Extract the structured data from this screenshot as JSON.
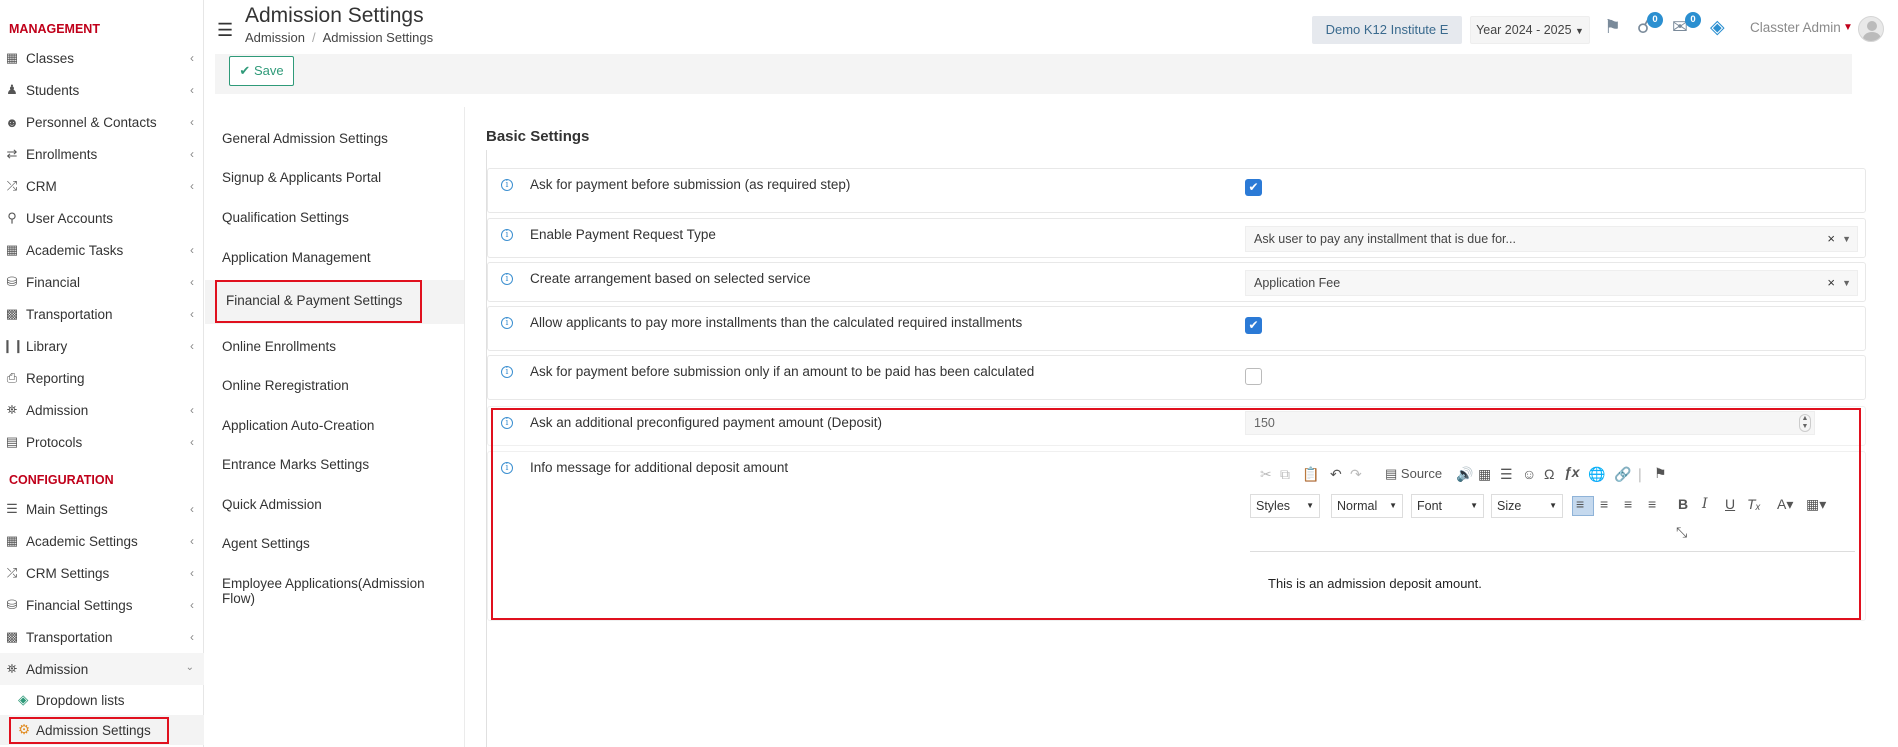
{
  "sidebar": {
    "management_title": "MANAGEMENT",
    "configuration_title": "CONFIGURATION",
    "management_items": [
      {
        "label": "Classes",
        "icon": "classes-icon"
      },
      {
        "label": "Students",
        "icon": "students-icon"
      },
      {
        "label": "Personnel & Contacts",
        "icon": "personnel-icon"
      },
      {
        "label": "Enrollments",
        "icon": "enrollments-icon"
      },
      {
        "label": "CRM",
        "icon": "crm-icon"
      },
      {
        "label": "User Accounts",
        "icon": "key-icon"
      },
      {
        "label": "Academic Tasks",
        "icon": "grid-icon"
      },
      {
        "label": "Financial",
        "icon": "financial-icon"
      },
      {
        "label": "Transportation",
        "icon": "bus-icon"
      },
      {
        "label": "Library",
        "icon": "library-icon"
      },
      {
        "label": "Reporting",
        "icon": "printer-icon"
      },
      {
        "label": "Admission",
        "icon": "institution-icon"
      },
      {
        "label": "Protocols",
        "icon": "protocols-icon"
      }
    ],
    "configuration_items": [
      {
        "label": "Main Settings",
        "icon": "sliders-icon"
      },
      {
        "label": "Academic Settings",
        "icon": "classes-icon"
      },
      {
        "label": "CRM Settings",
        "icon": "crm-icon"
      },
      {
        "label": "Financial Settings",
        "icon": "financial-icon"
      },
      {
        "label": "Transportation",
        "icon": "bus-icon"
      },
      {
        "label": "Admission",
        "icon": "institution-icon"
      }
    ],
    "admission_sub": [
      {
        "label": "Dropdown lists",
        "icon": "layers-icon"
      },
      {
        "label": "Admission Settings",
        "icon": "gear-icon"
      }
    ]
  },
  "header": {
    "title": "Admission Settings",
    "breadcrumb": [
      "Admission",
      "Admission Settings"
    ],
    "institute": "Demo K12 Institute E",
    "year": "Year 2024 - 2025",
    "notifications_count": "0",
    "messages_count": "0",
    "user_name": "Classter Admin"
  },
  "toolbar": {
    "save_label": "Save"
  },
  "settings_nav": [
    "General Admission Settings",
    "Signup & Applicants Portal",
    "Qualification Settings",
    "Application Management",
    "Financial & Payment Settings",
    "Online Enrollments",
    "Online Reregistration",
    "Application Auto-Creation",
    "Entrance Marks Settings",
    "Quick Admission",
    "Agent Settings",
    "Employee Applications(Admission",
    "Flow)"
  ],
  "main": {
    "section_title": "Basic Settings",
    "rows": [
      {
        "label": "Ask for payment before submission (as required step)",
        "checked": true
      },
      {
        "label": "Enable Payment Request Type",
        "value": "Ask user to pay any installment that is due for..."
      },
      {
        "label": "Create arrangement based on selected service",
        "value": "Application Fee"
      },
      {
        "label": "Allow applicants to pay more installments than the calculated required installments",
        "checked": true
      },
      {
        "label": "Ask for payment before submission only if an amount to be paid has been calculated",
        "checked": false
      },
      {
        "label": "Ask an additional preconfigured payment amount (Deposit)",
        "value": "150"
      },
      {
        "label": "Info message for additional deposit amount"
      }
    ],
    "editor": {
      "source_label": "Source",
      "styles_label": "Styles",
      "format_label": "Normal",
      "font_label": "Font",
      "size_label": "Size",
      "content": "This is an admission deposit amount."
    }
  },
  "colors": {
    "accent_red": "#c0001a",
    "save_green": "#2f9a79",
    "checkbox_blue": "#2b7ad6",
    "badge_blue": "#2b8fd0",
    "highlight_red": "#e0101e"
  }
}
